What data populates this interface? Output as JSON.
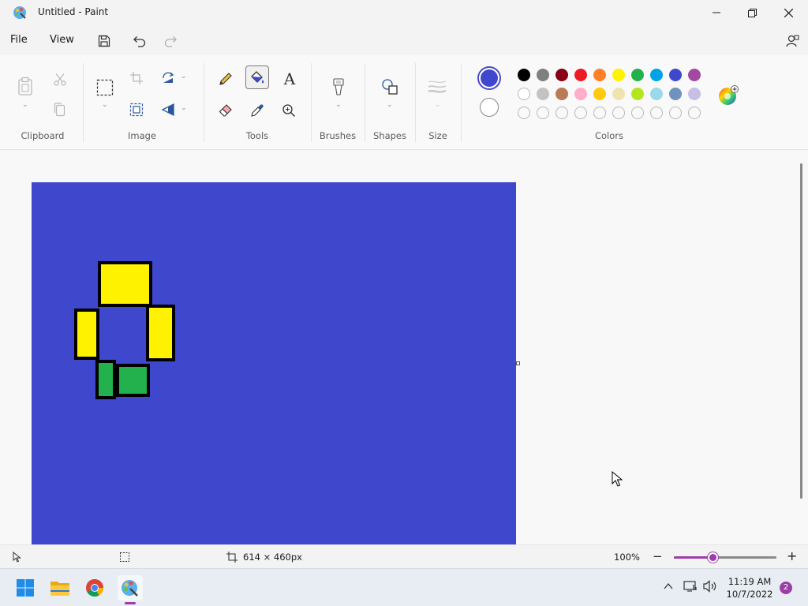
{
  "window": {
    "title": "Untitled - Paint"
  },
  "menu": {
    "file": "File",
    "view": "View"
  },
  "ribbon": {
    "groups": {
      "clipboard": "Clipboard",
      "image": "Image",
      "tools": "Tools",
      "brushes": "Brushes",
      "shapes": "Shapes",
      "size": "Size",
      "colors": "Colors"
    },
    "text_tool_glyph": "A"
  },
  "colors": {
    "primary": "#3f48cc",
    "secondary": "#ffffff",
    "palette_row1": [
      "#000000",
      "#7f7f7f",
      "#880015",
      "#ed1c24",
      "#ff7f27",
      "#fff200",
      "#22b14c",
      "#00a2e8",
      "#3f48cc",
      "#a349a4"
    ],
    "palette_row2": [
      "#ffffff",
      "#c3c3c3",
      "#b97a57",
      "#ffaec9",
      "#ffc90e",
      "#efe4b0",
      "#b5e61d",
      "#99d9ea",
      "#7092be",
      "#c8bfe7"
    ],
    "custom_slots": 10,
    "accent": "#9b3ea7",
    "canvas_bg": "#3f48cc",
    "shape_yellow": "#fff200",
    "shape_green": "#22b14c"
  },
  "status": {
    "canvas_size": "614 × 460px",
    "zoom": "100%",
    "zoom_fraction": 0.38
  },
  "taskbar": {
    "time": "11:19 AM",
    "date": "10/7/2022",
    "notifications": "2"
  }
}
